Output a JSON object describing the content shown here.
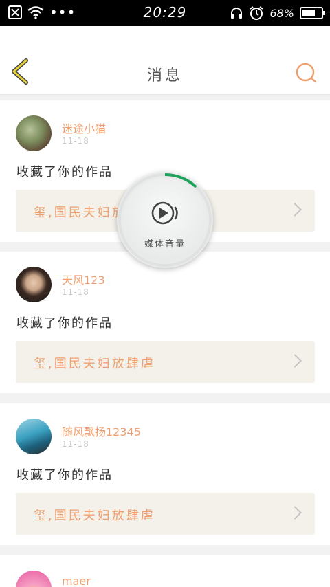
{
  "status_bar": {
    "time": "20:29",
    "battery": "68%",
    "battery_level": 0.68,
    "more": "•••"
  },
  "header": {
    "title": "消息"
  },
  "accent_color": "#f0a070",
  "feed": [
    {
      "user": "迷途小猫",
      "date": "11-18",
      "action": "收藏了你的作品",
      "work_title": "玺,国民夫妇放肆虐"
    },
    {
      "user": "天风123",
      "date": "11-18",
      "action": "收藏了你的作品",
      "work_title": "玺,国民夫妇放肆虐"
    },
    {
      "user": "随风飘扬12345",
      "date": "11-18",
      "action": "收藏了你的作品",
      "work_title": "玺,国民夫妇放肆虐"
    },
    {
      "user": "maer"
    }
  ],
  "media_overlay": {
    "label": "媒体音量",
    "level": 0.12
  }
}
